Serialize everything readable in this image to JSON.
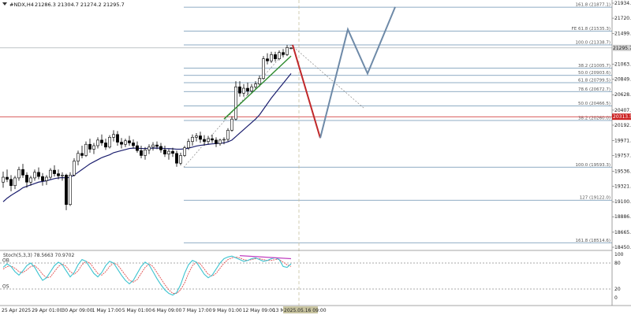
{
  "chart_data": {
    "type": "candlestick",
    "header": {
      "symbol_label": "#NDX,H4",
      "ohlc_label": "21286.3 21304.7 21274.2 21295.7"
    },
    "price_axis": {
      "min": 18450.0,
      "max": 21934.5,
      "ticks": [
        "21934.5",
        "21720.0",
        "21499.0",
        "21063.0",
        "20849.0",
        "20628.0",
        "20407.0",
        "20192.5",
        "19971.0",
        "19757.0",
        "19536.0",
        "19321.0",
        "19100.0",
        "18886.0",
        "18665.0",
        "18450.0"
      ],
      "current_price_label": "21295.7",
      "current_price": 21295.7,
      "red_line_label": "20313.5",
      "red_line_price": 20313.5
    },
    "time_axis": {
      "labels": [
        "25 Apr 2025",
        "29 Apr 01:00",
        "30 Apr 09:00",
        "1 May 17:00",
        "5 May 01:00",
        "6 May 09:00",
        "7 May 17:00",
        "9 May 01:00",
        "12 May 09:00",
        "13 May 17:00"
      ],
      "current_time_label": "2025.05.16 09:00",
      "current_bar_index": 73
    },
    "candles": [
      [
        19380,
        19530,
        19300,
        19450
      ],
      [
        19450,
        19560,
        19380,
        19420
      ],
      [
        19420,
        19480,
        19250,
        19330
      ],
      [
        19330,
        19470,
        19280,
        19440
      ],
      [
        19440,
        19600,
        19400,
        19560
      ],
      [
        19560,
        19640,
        19440,
        19480
      ],
      [
        19480,
        19520,
        19300,
        19380
      ],
      [
        19380,
        19470,
        19330,
        19440
      ],
      [
        19440,
        19560,
        19400,
        19520
      ],
      [
        19520,
        19590,
        19420,
        19460
      ],
      [
        19460,
        19510,
        19330,
        19400
      ],
      [
        19400,
        19480,
        19340,
        19450
      ],
      [
        19450,
        19580,
        19420,
        19550
      ],
      [
        19550,
        19620,
        19460,
        19500
      ],
      [
        19500,
        19560,
        19420,
        19470
      ],
      [
        19470,
        19520,
        19400,
        19480
      ],
      [
        19480,
        19500,
        18980,
        19060
      ],
      [
        19060,
        19520,
        19040,
        19480
      ],
      [
        19480,
        19720,
        19460,
        19680
      ],
      [
        19680,
        19830,
        19620,
        19790
      ],
      [
        19790,
        19900,
        19720,
        19760
      ],
      [
        19760,
        19960,
        19740,
        19920
      ],
      [
        19920,
        20000,
        19800,
        19850
      ],
      [
        19850,
        19940,
        19780,
        19900
      ],
      [
        19900,
        20020,
        19860,
        19980
      ],
      [
        19980,
        20060,
        19900,
        19940
      ],
      [
        19940,
        20000,
        19840,
        19880
      ],
      [
        19880,
        20050,
        19860,
        20020
      ],
      [
        20020,
        20120,
        19960,
        20060
      ],
      [
        20060,
        20110,
        19900,
        19950
      ],
      [
        19950,
        20010,
        19860,
        19920
      ],
      [
        19920,
        20000,
        19880,
        19970
      ],
      [
        19970,
        20040,
        19900,
        19940
      ],
      [
        19940,
        19990,
        19860,
        19900
      ],
      [
        19900,
        19960,
        19800,
        19830
      ],
      [
        19830,
        19900,
        19720,
        19760
      ],
      [
        19760,
        19880,
        19700,
        19840
      ],
      [
        19840,
        19920,
        19780,
        19880
      ],
      [
        19880,
        19950,
        19830,
        19910
      ],
      [
        19910,
        19960,
        19850,
        19890
      ],
      [
        19890,
        19940,
        19800,
        19840
      ],
      [
        19840,
        19900,
        19740,
        19780
      ],
      [
        19780,
        19850,
        19700,
        19820
      ],
      [
        19820,
        19870,
        19740,
        19790
      ],
      [
        19790,
        19830,
        19600,
        19650
      ],
      [
        19650,
        19800,
        19620,
        19760
      ],
      [
        19760,
        19900,
        19740,
        19870
      ],
      [
        19870,
        20000,
        19840,
        19960
      ],
      [
        19960,
        20060,
        19900,
        20020
      ],
      [
        20020,
        20080,
        19960,
        20040
      ],
      [
        20040,
        20100,
        19940,
        19990
      ],
      [
        19990,
        20050,
        19900,
        19960
      ],
      [
        19960,
        20040,
        19920,
        20000
      ],
      [
        20000,
        20060,
        19940,
        19980
      ],
      [
        19980,
        20020,
        19880,
        19930
      ],
      [
        19930,
        20000,
        19900,
        19980
      ],
      [
        19980,
        20020,
        19920,
        19990
      ],
      [
        19990,
        20150,
        19960,
        20120
      ],
      [
        20120,
        20320,
        20100,
        20280
      ],
      [
        20280,
        20820,
        20260,
        20740
      ],
      [
        20740,
        20820,
        20600,
        20650
      ],
      [
        20650,
        20780,
        20600,
        20720
      ],
      [
        20720,
        20800,
        20620,
        20680
      ],
      [
        20680,
        20780,
        20640,
        20740
      ],
      [
        20740,
        20820,
        20700,
        20780
      ],
      [
        20780,
        20900,
        20740,
        20860
      ],
      [
        20860,
        21180,
        20840,
        21140
      ],
      [
        21140,
        21220,
        21060,
        21110
      ],
      [
        21110,
        21240,
        21080,
        21200
      ],
      [
        21200,
        21240,
        21100,
        21140
      ],
      [
        21140,
        21260,
        21120,
        21230
      ],
      [
        21230,
        21280,
        21160,
        21200
      ],
      [
        21200,
        21338,
        21180,
        21300
      ],
      [
        21286.3,
        21304.7,
        21274.2,
        21295.7
      ]
    ],
    "moving_average": [
      19100,
      19150,
      19190,
      19225,
      19260,
      19300,
      19320,
      19340,
      19360,
      19380,
      19390,
      19400,
      19415,
      19430,
      19440,
      19445,
      19440,
      19450,
      19480,
      19520,
      19560,
      19600,
      19640,
      19670,
      19700,
      19730,
      19750,
      19770,
      19800,
      19815,
      19830,
      19845,
      19860,
      19865,
      19865,
      19860,
      19860,
      19862,
      19865,
      19866,
      19864,
      19860,
      19858,
      19855,
      19850,
      19850,
      19855,
      19865,
      19880,
      19895,
      19905,
      19912,
      19920,
      19926,
      19930,
      19935,
      19940,
      19955,
      19980,
      20030,
      20080,
      20130,
      20180,
      20230,
      20280,
      20340,
      20420,
      20500,
      20580,
      20650,
      20720,
      20790,
      20860,
      20930
    ],
    "fib_levels": [
      {
        "label": "161.8 (21877.1)",
        "value": 21877.1
      },
      {
        "label": "FE 61.8 (21535.3)",
        "value": 21535.3
      },
      {
        "label": "100.0 (21338.7)",
        "value": 21338.7
      },
      {
        "label": "38.2 (21005.7)",
        "value": 21005.7
      },
      {
        "label": "50.0 (20903.6)",
        "value": 20903.6
      },
      {
        "label": "61.8 (20799.5)",
        "value": 20799.5
      },
      {
        "label": "78.6 (20672.7)",
        "value": 20672.7
      },
      {
        "label": "50.0 (20466.5)",
        "value": 20466.5
      },
      {
        "label": "38.2 (20260.0)",
        "value": 20260.0
      },
      {
        "label": "100.0 (19593.3)",
        "value": 19593.3
      },
      {
        "label": "127 (19122.0)",
        "value": 19122.0
      },
      {
        "label": "161.8 (18514.6)",
        "value": 18514.6
      }
    ],
    "projection_path": {
      "red_leg": [
        [
          73,
          21338
        ],
        [
          80,
          20010
        ]
      ],
      "blue_leg": [
        [
          80,
          20010
        ],
        [
          87,
          21560
        ],
        [
          92,
          20930
        ],
        [
          99,
          21880
        ]
      ]
    },
    "trend_line": [
      [
        56,
        20280
      ],
      [
        73,
        21180
      ]
    ],
    "stochastic": {
      "label": "Stoch(5,3,3) 78.5663 70.9702",
      "ob_label": "OB",
      "os_label": "OS",
      "ob_level": 80,
      "os_level": 20,
      "min": 0,
      "max": 100,
      "ticks": [
        "100",
        "80",
        "20",
        "0"
      ],
      "k": [
        70,
        78,
        72,
        60,
        52,
        62,
        74,
        80,
        70,
        54,
        40,
        46,
        60,
        74,
        82,
        76,
        62,
        48,
        58,
        76,
        88,
        84,
        70,
        56,
        48,
        58,
        74,
        84,
        80,
        66,
        52,
        40,
        32,
        40,
        56,
        72,
        82,
        76,
        60,
        44,
        30,
        18,
        10,
        6,
        12,
        30,
        56,
        76,
        86,
        82,
        68,
        54,
        46,
        52,
        66,
        80,
        90,
        94,
        96,
        92,
        88,
        84,
        86,
        90,
        92,
        88,
        84,
        86,
        90,
        92,
        88,
        72,
        70,
        78
      ],
      "d": [
        66,
        72,
        73,
        68,
        60,
        58,
        64,
        72,
        74,
        66,
        54,
        46,
        48,
        60,
        72,
        78,
        72,
        60,
        54,
        62,
        76,
        84,
        80,
        68,
        56,
        52,
        60,
        72,
        80,
        76,
        64,
        52,
        40,
        36,
        42,
        56,
        70,
        78,
        72,
        58,
        44,
        30,
        18,
        10,
        10,
        18,
        34,
        56,
        74,
        82,
        78,
        66,
        54,
        50,
        56,
        68,
        80,
        88,
        92,
        94,
        92,
        88,
        86,
        88,
        90,
        90,
        88,
        86,
        86,
        88,
        88,
        82,
        76,
        72
      ]
    },
    "colors": {
      "bull_candle": "#ffffff",
      "bear_candle": "#000000",
      "moving_average": "#1b1e6e",
      "red_line": "#cc2222",
      "projection_red": "#c0282a",
      "projection_blue": "#6e8aa8",
      "trend_line": "#2e8b2e",
      "fib_line": "#6a90b0",
      "stoch_k": "#3cc4d0",
      "stoch_d": "#e05050",
      "divergence": "#c040c0",
      "current_time_label_bg": "#c8c4a0"
    }
  }
}
